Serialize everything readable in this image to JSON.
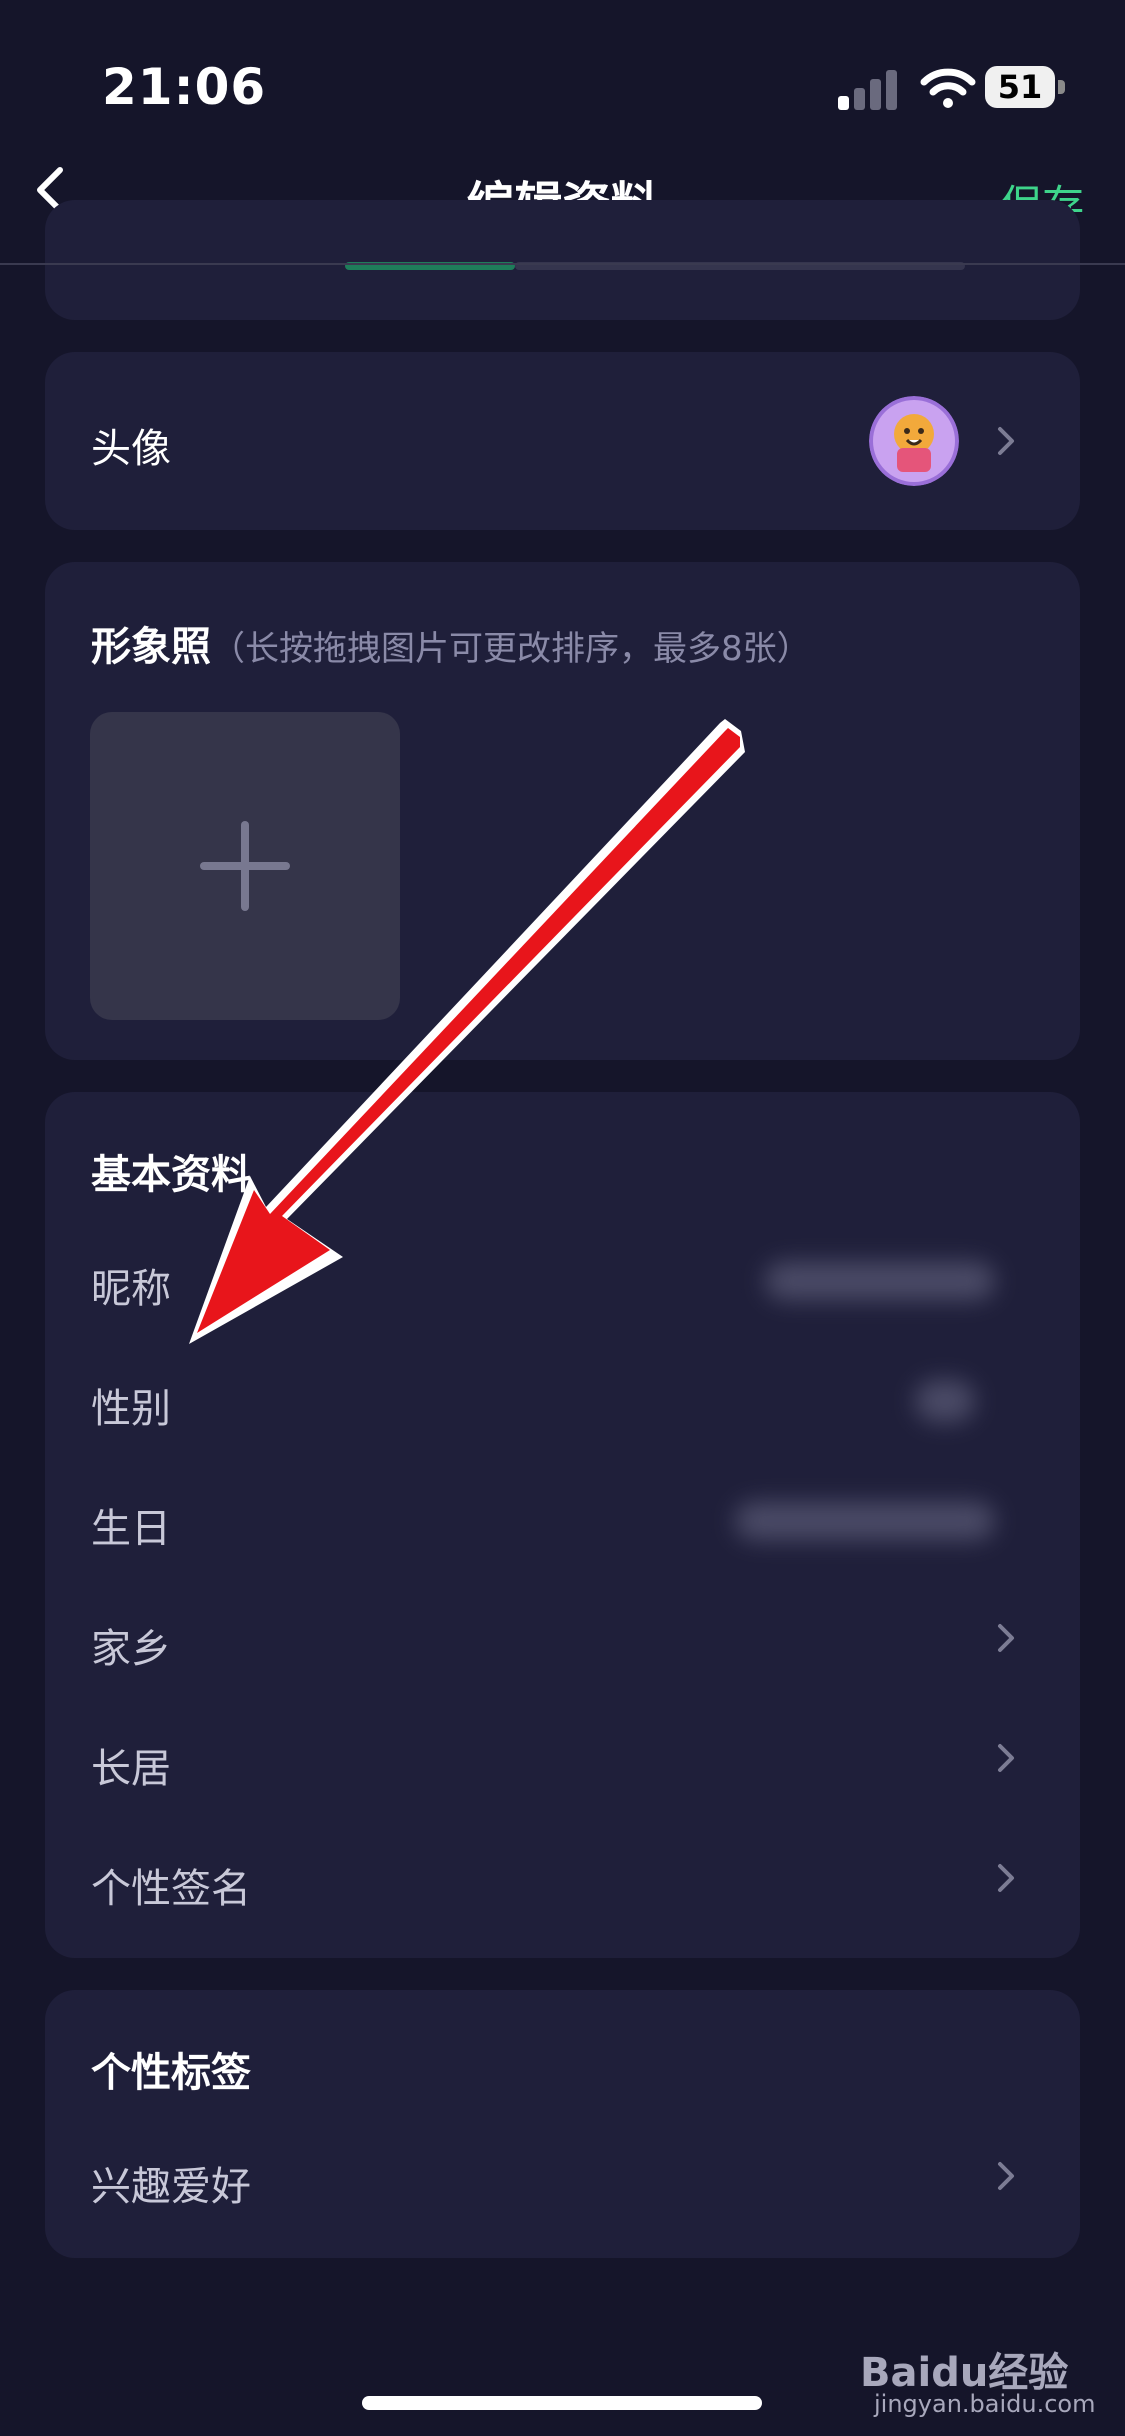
{
  "status_bar": {
    "time": "21:06",
    "battery": "51"
  },
  "nav": {
    "title": "编辑资料",
    "save": "保存"
  },
  "avatar_row": {
    "label": "头像"
  },
  "photos": {
    "title": "形象照",
    "hint": "（长按拖拽图片可更改排序，最多8张）"
  },
  "basic": {
    "title": "基本资料",
    "rows": [
      {
        "label": "昵称"
      },
      {
        "label": "性别"
      },
      {
        "label": "生日"
      },
      {
        "label": "家乡"
      },
      {
        "label": "长居"
      },
      {
        "label": "个性签名"
      }
    ]
  },
  "tags": {
    "title": "个性标签",
    "rows": [
      {
        "label": "兴趣爱好"
      }
    ]
  },
  "watermark": {
    "brand": "Baidu经验",
    "url": "jingyan.baidu.com"
  },
  "colors": {
    "accent": "#3ed48b",
    "annotation_arrow": "#e8151b",
    "background": "#15152a",
    "card": "#1f1f3a"
  }
}
